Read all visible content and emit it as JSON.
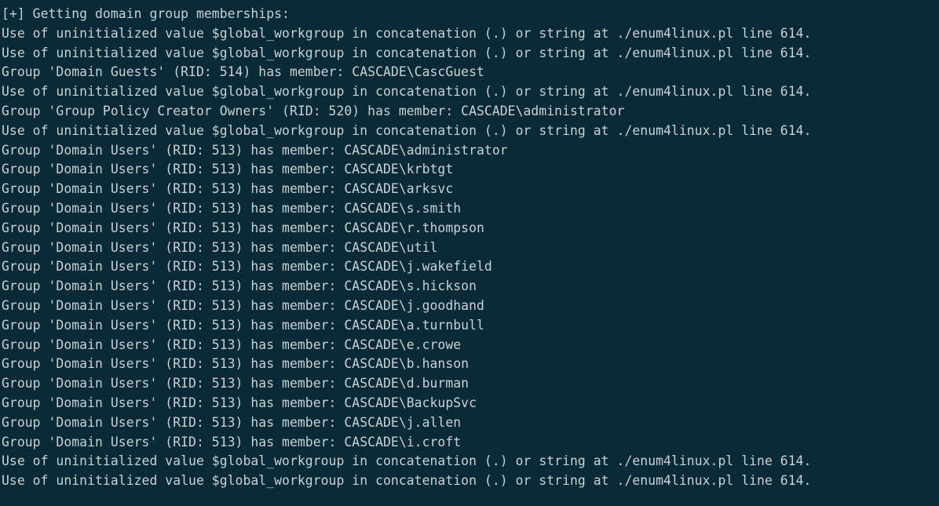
{
  "terminal": {
    "lines": [
      "[+] Getting domain group memberships:",
      "Use of uninitialized value $global_workgroup in concatenation (.) or string at ./enum4linux.pl line 614.",
      "Use of uninitialized value $global_workgroup in concatenation (.) or string at ./enum4linux.pl line 614.",
      "Group 'Domain Guests' (RID: 514) has member: CASCADE\\CascGuest",
      "Use of uninitialized value $global_workgroup in concatenation (.) or string at ./enum4linux.pl line 614.",
      "Group 'Group Policy Creator Owners' (RID: 520) has member: CASCADE\\administrator",
      "Use of uninitialized value $global_workgroup in concatenation (.) or string at ./enum4linux.pl line 614.",
      "Group 'Domain Users' (RID: 513) has member: CASCADE\\administrator",
      "Group 'Domain Users' (RID: 513) has member: CASCADE\\krbtgt",
      "Group 'Domain Users' (RID: 513) has member: CASCADE\\arksvc",
      "Group 'Domain Users' (RID: 513) has member: CASCADE\\s.smith",
      "Group 'Domain Users' (RID: 513) has member: CASCADE\\r.thompson",
      "Group 'Domain Users' (RID: 513) has member: CASCADE\\util",
      "Group 'Domain Users' (RID: 513) has member: CASCADE\\j.wakefield",
      "Group 'Domain Users' (RID: 513) has member: CASCADE\\s.hickson",
      "Group 'Domain Users' (RID: 513) has member: CASCADE\\j.goodhand",
      "Group 'Domain Users' (RID: 513) has member: CASCADE\\a.turnbull",
      "Group 'Domain Users' (RID: 513) has member: CASCADE\\e.crowe",
      "Group 'Domain Users' (RID: 513) has member: CASCADE\\b.hanson",
      "Group 'Domain Users' (RID: 513) has member: CASCADE\\d.burman",
      "Group 'Domain Users' (RID: 513) has member: CASCADE\\BackupSvc",
      "Group 'Domain Users' (RID: 513) has member: CASCADE\\j.allen",
      "Group 'Domain Users' (RID: 513) has member: CASCADE\\i.croft",
      "Use of uninitialized value $global_workgroup in concatenation (.) or string at ./enum4linux.pl line 614.",
      "Use of uninitialized value $global_workgroup in concatenation (.) or string at ./enum4linux.pl line 614."
    ],
    "colors": {
      "background": "#092a36",
      "text": "#c9d2d4"
    }
  }
}
